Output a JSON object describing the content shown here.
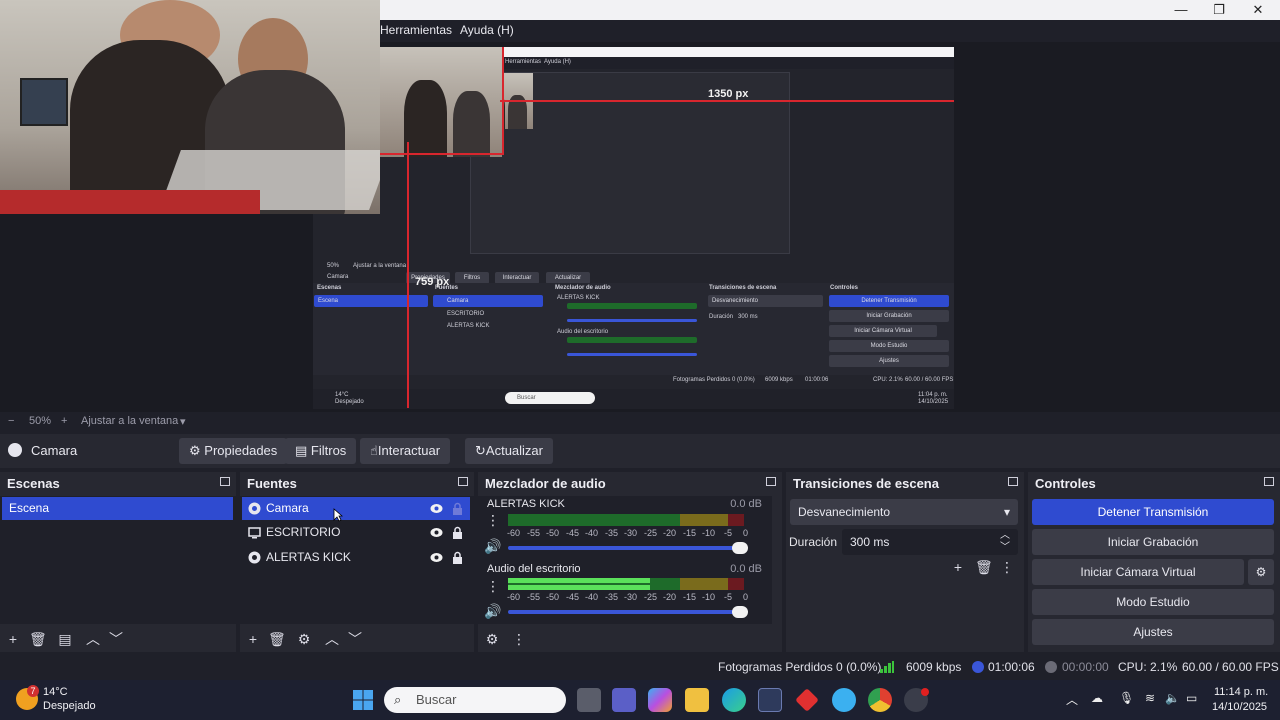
{
  "menu": {
    "tools": "Herramientas",
    "help": "Ayuda (H)"
  },
  "preview": {
    "label_width": "1350 px",
    "label_height": "759 px",
    "inner": {
      "menu_tools": "Herramientas",
      "menu_help": "Ayuda (H)",
      "zoom": "50%",
      "fit": "Ajustar a la ventana",
      "source": "Camara",
      "props": "Propiedades",
      "filters": "Filtros",
      "interact": "Interactuar",
      "refresh": "Actualizar",
      "scenes_title": "Escenas",
      "scene": "Escena",
      "sources_title": "Fuentes",
      "src1": "Camara",
      "src2": "ESCRITORIO",
      "src3": "ALERTAS KICK",
      "mixer_title": "Mezclador de audio",
      "mix1": "ALERTAS KICK",
      "mix2": "Audio del escritorio",
      "trans_title": "Transiciones de escena",
      "trans": "Desvanecimiento",
      "duration_label": "Duración",
      "duration": "300 ms",
      "controls_title": "Controles",
      "c1": "Detener Transmisión",
      "c2": "Iniciar Grabación",
      "c3": "Iniciar Cámara Virtual",
      "c4": "Modo Estudio",
      "c5": "Ajustes",
      "status": "Fotogramas Perdidos 0 (0.0%)",
      "kbps": "6009 kbps",
      "time": "01:00:06",
      "cpu": "CPU: 2.1%",
      "fps": "60.00 / 60.00 FPS",
      "search": "Buscar",
      "weather_temp": "14°C",
      "weather": "Despejado",
      "clock_time": "11:04 p. m.",
      "clock_date": "14/10/2025"
    }
  },
  "zoombar": {
    "minus": "−",
    "zoom": "50%",
    "plus": "+",
    "fit": "Ajustar a la ventana"
  },
  "source_toolbar": {
    "current": "Camara",
    "properties": "Propiedades",
    "filters": "Filtros",
    "interact": "Interactuar",
    "refresh": "Actualizar"
  },
  "scenes": {
    "title": "Escenas",
    "items": [
      "Escena"
    ]
  },
  "sources": {
    "title": "Fuentes",
    "items": [
      {
        "label": "Camara",
        "selected": true
      },
      {
        "label": "ESCRITORIO",
        "selected": false
      },
      {
        "label": "ALERTAS KICK",
        "selected": false
      }
    ]
  },
  "mixer": {
    "title": "Mezclador de audio",
    "channels": [
      {
        "label": "ALERTAS KICK",
        "db": "0.0 dB",
        "level": 0.0
      },
      {
        "label": "Audio del escritorio",
        "db": "0.0 dB",
        "level": 0.6
      }
    ],
    "scale": [
      "-60",
      "-55",
      "-50",
      "-45",
      "-40",
      "-35",
      "-30",
      "-25",
      "-20",
      "-15",
      "-10",
      "-5",
      "0"
    ]
  },
  "transitions": {
    "title": "Transiciones de escena",
    "selected": "Desvanecimiento",
    "duration_label": "Duración",
    "duration": "300 ms"
  },
  "controls": {
    "title": "Controles",
    "stop_stream": "Detener Transmisión",
    "start_recording": "Iniciar Grabación",
    "start_virtual_cam": "Iniciar Cámara Virtual",
    "studio_mode": "Modo Estudio",
    "settings": "Ajustes"
  },
  "status": {
    "dropped": "Fotogramas Perdidos 0 (0.0%)",
    "kbps": "6009 kbps",
    "stream_time": "01:00:06",
    "rec_time": "00:00:00",
    "cpu": "CPU: 2.1%",
    "fps": "60.00 / 60.00 FPS"
  },
  "taskbar": {
    "weather_temp": "14°C",
    "weather_text": "Despejado",
    "weather_badge": "7",
    "search_placeholder": "Buscar",
    "time": "11:14 p. m.",
    "date": "14/10/2025"
  },
  "colors": {
    "accent": "#2f4bd0",
    "bg": "#1f2029",
    "panel": "#272831",
    "red_guide": "#d8262e"
  }
}
